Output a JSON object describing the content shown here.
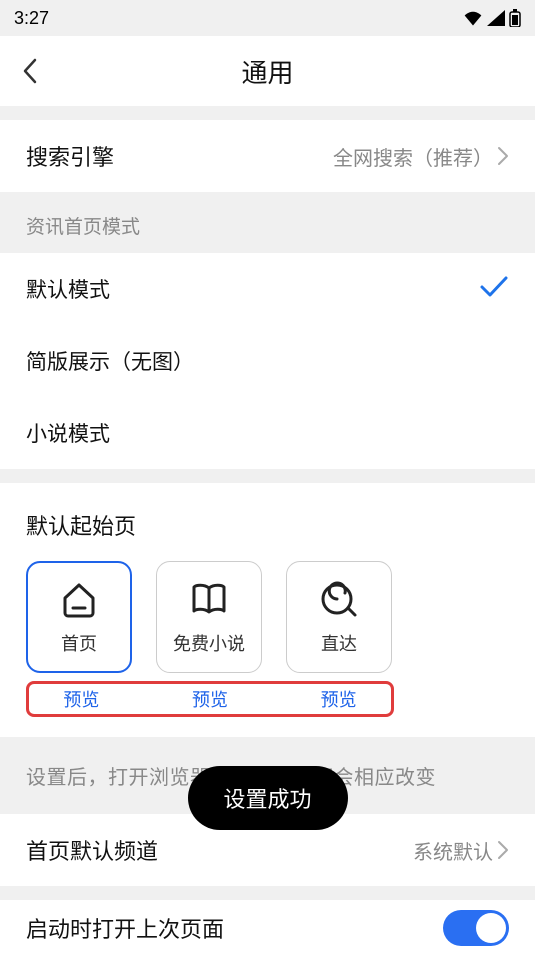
{
  "status": {
    "time": "3:27"
  },
  "header": {
    "title": "通用"
  },
  "search_engine": {
    "label": "搜索引擎",
    "value": "全网搜索（推荐）"
  },
  "homepage_mode": {
    "hint": "资讯首页模式",
    "options": [
      {
        "label": "默认模式",
        "selected": true
      },
      {
        "label": "简版展示（无图）",
        "selected": false
      },
      {
        "label": "小说模式",
        "selected": false
      }
    ]
  },
  "default_start": {
    "title": "默认起始页",
    "cards": [
      {
        "label": "首页",
        "icon": "home"
      },
      {
        "label": "免费小说",
        "icon": "book"
      },
      {
        "label": "直达",
        "icon": "target"
      }
    ],
    "preview_label": "预览",
    "desc": "设置后，打开浏览器时展示的页面会相应改变"
  },
  "default_channel": {
    "label": "首页默认频道",
    "value": "系统默认"
  },
  "restore_last": {
    "label": "启动时打开上次页面",
    "on": true
  },
  "toast": {
    "text": "设置成功"
  }
}
